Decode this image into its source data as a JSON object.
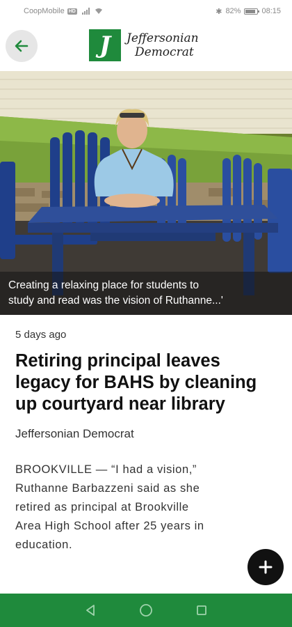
{
  "status_bar": {
    "carrier": "CoopMobile",
    "network_badge": "HD",
    "battery": "82%",
    "battery_level": 0.82,
    "time": "08:15",
    "icons": [
      "signal-icon",
      "wifi-icon",
      "bluetooth-icon",
      "battery-icon"
    ]
  },
  "header": {
    "back_icon": "arrow-left-icon",
    "logo_letter": "J",
    "logo_line1": "Jeffersonian",
    "logo_line2": "Democrat",
    "brand_color": "#1f8a3c"
  },
  "hero": {
    "caption_line1": "Creating a relaxing place for students to",
    "caption_line2": "study and read was the vision of Ruthanne...'"
  },
  "article": {
    "timestamp": "5 days ago",
    "headline": "Retiring principal leaves legacy for BAHS by cleaning up courtyard near library",
    "source": "Jeffersonian Democrat",
    "body_lines": [
      "BROOKVILLE — “I had a vision,”",
      "Ruthanne Barbazzeni said as she",
      "retired as principal at Brookville",
      "Area High School after 25 years in",
      "education."
    ]
  },
  "fab": {
    "icon": "plus-icon"
  },
  "nav": {
    "icons": [
      "back-triangle-icon",
      "home-circle-icon",
      "recents-square-icon"
    ],
    "color": "#1f8a3c"
  }
}
